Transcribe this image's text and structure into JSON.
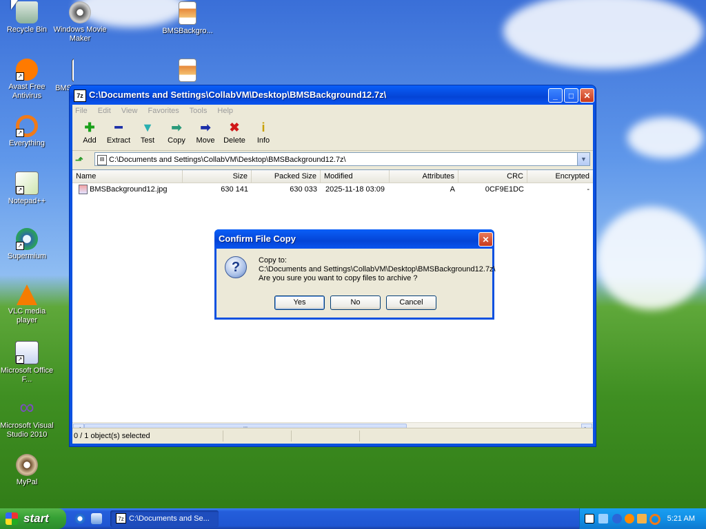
{
  "desktop": {
    "icons": [
      {
        "label": "Recycle Bin"
      },
      {
        "label": "Windows Movie Maker"
      },
      {
        "label": "BMSBackgro..."
      },
      {
        "label": "Avast Free Antivirus"
      },
      {
        "label": "BMS"
      },
      {
        "label": "Everything"
      },
      {
        "label": "Notepad++"
      },
      {
        "label": "Supermium"
      },
      {
        "label": "VLC media player"
      },
      {
        "label": "Microsoft Office F..."
      },
      {
        "label": "Microsoft Visual Studio 2010"
      },
      {
        "label": "MyPal"
      }
    ]
  },
  "window": {
    "title": "C:\\Documents and Settings\\CollabVM\\Desktop\\BMSBackground12.7z\\",
    "app_icon_text": "7z",
    "controls": {
      "minimize": "_",
      "maximize": "□",
      "close": "✕"
    },
    "menu": [
      "File",
      "Edit",
      "View",
      "Favorites",
      "Tools",
      "Help"
    ],
    "toolbar": [
      {
        "label": "Add",
        "glyph": "✚",
        "color": "#1aa01a"
      },
      {
        "label": "Extract",
        "glyph": "━",
        "color": "#1b2ea8"
      },
      {
        "label": "Test",
        "glyph": "▼",
        "color": "#2ab0b0"
      },
      {
        "label": "Copy",
        "glyph": "➡",
        "color": "#2a9a7a"
      },
      {
        "label": "Move",
        "glyph": "➡",
        "color": "#1b2ea8"
      },
      {
        "label": "Delete",
        "glyph": "✖",
        "color": "#d01818"
      },
      {
        "label": "Info",
        "glyph": "i",
        "color": "#c8a000"
      }
    ],
    "address": "C:\\Documents and Settings\\CollabVM\\Desktop\\BMSBackground12.7z\\",
    "columns": [
      "Name",
      "Size",
      "Packed Size",
      "Modified",
      "Attributes",
      "CRC",
      "Encrypted"
    ],
    "rows": [
      {
        "name": "BMSBackground12.jpg",
        "size": "630 141",
        "packed": "630 033",
        "modified": "2025-11-18 03:09",
        "attributes": "A",
        "crc": "0CF9E1DC",
        "encrypted": "-"
      }
    ],
    "status": "0 / 1 object(s) selected"
  },
  "dialog": {
    "title": "Confirm File Copy",
    "icon": "?",
    "line1": "Copy to:",
    "line2": "C:\\Documents and Settings\\CollabVM\\Desktop\\BMSBackground12.7z\\",
    "line3": "Are you sure you want to copy files to archive ?",
    "buttons": {
      "yes": "Yes",
      "no": "No",
      "cancel": "Cancel"
    }
  },
  "taskbar": {
    "start_label": "start",
    "task_icon": "7z",
    "task_label": "C:\\Documents and Se...",
    "clock": "5:21 AM"
  }
}
